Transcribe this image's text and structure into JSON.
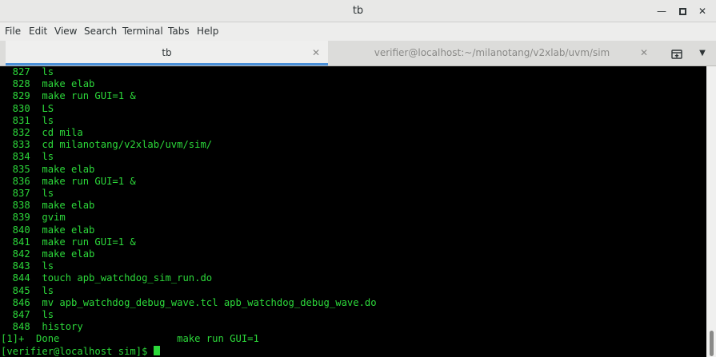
{
  "window": {
    "title": "tb"
  },
  "menu": {
    "items": [
      "File",
      "Edit",
      "View",
      "Search",
      "Terminal",
      "Tabs",
      "Help"
    ]
  },
  "tabs": [
    {
      "label": "tb",
      "active": true
    },
    {
      "label": "verifier@localhost:~/milanotang/v2xlab/uvm/sim",
      "active": false
    }
  ],
  "terminal": {
    "lines": [
      "  827  ls",
      "  828  make elab",
      "  829  make run GUI=1 &",
      "  830  LS",
      "  831  ls",
      "  832  cd mila",
      "  833  cd milanotang/v2xlab/uvm/sim/",
      "  834  ls",
      "  835  make elab",
      "  836  make run GUI=1 &",
      "  837  ls",
      "  838  make elab",
      "  839  gvim",
      "  840  make elab",
      "  841  make run GUI=1 &",
      "  842  make elab",
      "  843  ls",
      "  844  touch apb_watchdog_sim_run.do",
      "  845  ls",
      "  846  mv apb_watchdog_debug_wave.tcl apb_watchdog_debug_wave.do",
      "  847  ls",
      "  848  history",
      "[1]+  Done                    make run GUI=1"
    ],
    "prompt": "[verifier@localhost sim]$ "
  },
  "colors": {
    "terminal_fg": "#2cd83a",
    "terminal_bg": "#000000",
    "tab_accent": "#4a90d9"
  }
}
